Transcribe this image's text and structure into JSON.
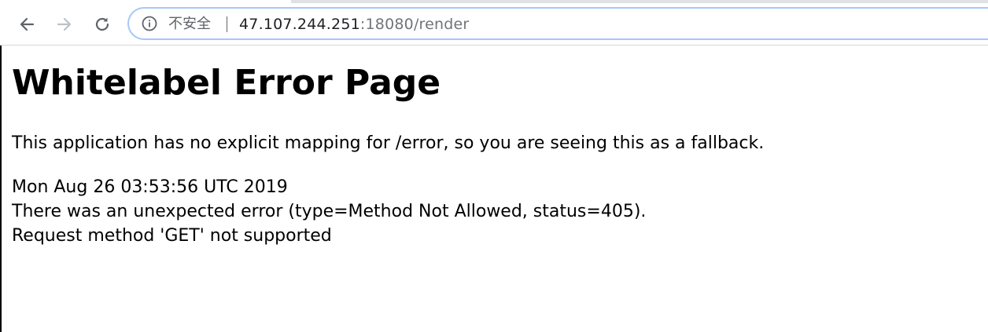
{
  "browser": {
    "security_label": "不安全",
    "url_host": "47.107.244.251",
    "url_rest": ":18080/render",
    "icons": {
      "back": "back-arrow-icon",
      "forward": "forward-arrow-icon",
      "reload": "reload-icon",
      "info": "info-icon"
    }
  },
  "page": {
    "title": "Whitelabel Error Page",
    "message": "This application has no explicit mapping for /error, so you are seeing this as a fallback.",
    "timestamp": "Mon Aug 26 03:53:56 UTC 2019",
    "error_line": "There was an unexpected error (type=Method Not Allowed, status=405).",
    "detail": "Request method 'GET' not supported"
  }
}
